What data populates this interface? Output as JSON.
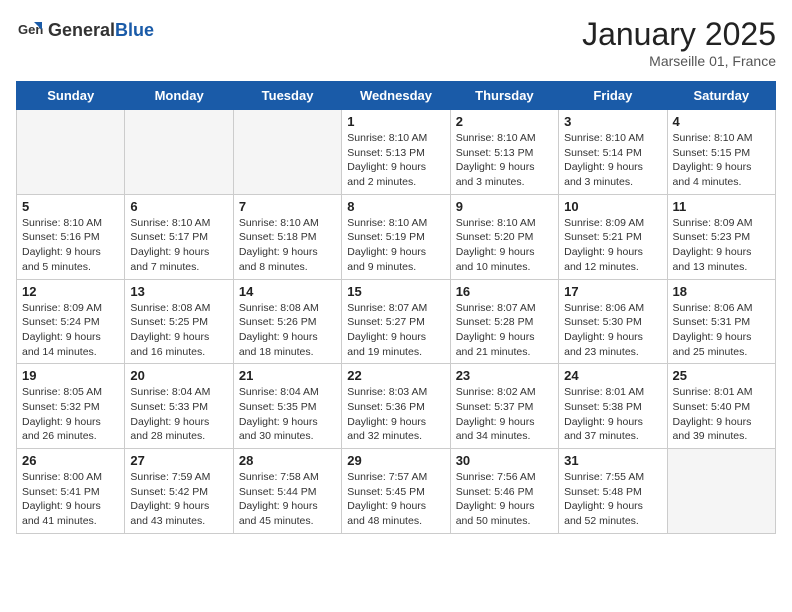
{
  "logo": {
    "general": "General",
    "blue": "Blue"
  },
  "title": "January 2025",
  "location": "Marseille 01, France",
  "weekdays": [
    "Sunday",
    "Monday",
    "Tuesday",
    "Wednesday",
    "Thursday",
    "Friday",
    "Saturday"
  ],
  "weeks": [
    [
      {
        "day": "",
        "info": ""
      },
      {
        "day": "",
        "info": ""
      },
      {
        "day": "",
        "info": ""
      },
      {
        "day": "1",
        "info": "Sunrise: 8:10 AM\nSunset: 5:13 PM\nDaylight: 9 hours\nand 2 minutes."
      },
      {
        "day": "2",
        "info": "Sunrise: 8:10 AM\nSunset: 5:13 PM\nDaylight: 9 hours\nand 3 minutes."
      },
      {
        "day": "3",
        "info": "Sunrise: 8:10 AM\nSunset: 5:14 PM\nDaylight: 9 hours\nand 3 minutes."
      },
      {
        "day": "4",
        "info": "Sunrise: 8:10 AM\nSunset: 5:15 PM\nDaylight: 9 hours\nand 4 minutes."
      }
    ],
    [
      {
        "day": "5",
        "info": "Sunrise: 8:10 AM\nSunset: 5:16 PM\nDaylight: 9 hours\nand 5 minutes."
      },
      {
        "day": "6",
        "info": "Sunrise: 8:10 AM\nSunset: 5:17 PM\nDaylight: 9 hours\nand 7 minutes."
      },
      {
        "day": "7",
        "info": "Sunrise: 8:10 AM\nSunset: 5:18 PM\nDaylight: 9 hours\nand 8 minutes."
      },
      {
        "day": "8",
        "info": "Sunrise: 8:10 AM\nSunset: 5:19 PM\nDaylight: 9 hours\nand 9 minutes."
      },
      {
        "day": "9",
        "info": "Sunrise: 8:10 AM\nSunset: 5:20 PM\nDaylight: 9 hours\nand 10 minutes."
      },
      {
        "day": "10",
        "info": "Sunrise: 8:09 AM\nSunset: 5:21 PM\nDaylight: 9 hours\nand 12 minutes."
      },
      {
        "day": "11",
        "info": "Sunrise: 8:09 AM\nSunset: 5:23 PM\nDaylight: 9 hours\nand 13 minutes."
      }
    ],
    [
      {
        "day": "12",
        "info": "Sunrise: 8:09 AM\nSunset: 5:24 PM\nDaylight: 9 hours\nand 14 minutes."
      },
      {
        "day": "13",
        "info": "Sunrise: 8:08 AM\nSunset: 5:25 PM\nDaylight: 9 hours\nand 16 minutes."
      },
      {
        "day": "14",
        "info": "Sunrise: 8:08 AM\nSunset: 5:26 PM\nDaylight: 9 hours\nand 18 minutes."
      },
      {
        "day": "15",
        "info": "Sunrise: 8:07 AM\nSunset: 5:27 PM\nDaylight: 9 hours\nand 19 minutes."
      },
      {
        "day": "16",
        "info": "Sunrise: 8:07 AM\nSunset: 5:28 PM\nDaylight: 9 hours\nand 21 minutes."
      },
      {
        "day": "17",
        "info": "Sunrise: 8:06 AM\nSunset: 5:30 PM\nDaylight: 9 hours\nand 23 minutes."
      },
      {
        "day": "18",
        "info": "Sunrise: 8:06 AM\nSunset: 5:31 PM\nDaylight: 9 hours\nand 25 minutes."
      }
    ],
    [
      {
        "day": "19",
        "info": "Sunrise: 8:05 AM\nSunset: 5:32 PM\nDaylight: 9 hours\nand 26 minutes."
      },
      {
        "day": "20",
        "info": "Sunrise: 8:04 AM\nSunset: 5:33 PM\nDaylight: 9 hours\nand 28 minutes."
      },
      {
        "day": "21",
        "info": "Sunrise: 8:04 AM\nSunset: 5:35 PM\nDaylight: 9 hours\nand 30 minutes."
      },
      {
        "day": "22",
        "info": "Sunrise: 8:03 AM\nSunset: 5:36 PM\nDaylight: 9 hours\nand 32 minutes."
      },
      {
        "day": "23",
        "info": "Sunrise: 8:02 AM\nSunset: 5:37 PM\nDaylight: 9 hours\nand 34 minutes."
      },
      {
        "day": "24",
        "info": "Sunrise: 8:01 AM\nSunset: 5:38 PM\nDaylight: 9 hours\nand 37 minutes."
      },
      {
        "day": "25",
        "info": "Sunrise: 8:01 AM\nSunset: 5:40 PM\nDaylight: 9 hours\nand 39 minutes."
      }
    ],
    [
      {
        "day": "26",
        "info": "Sunrise: 8:00 AM\nSunset: 5:41 PM\nDaylight: 9 hours\nand 41 minutes."
      },
      {
        "day": "27",
        "info": "Sunrise: 7:59 AM\nSunset: 5:42 PM\nDaylight: 9 hours\nand 43 minutes."
      },
      {
        "day": "28",
        "info": "Sunrise: 7:58 AM\nSunset: 5:44 PM\nDaylight: 9 hours\nand 45 minutes."
      },
      {
        "day": "29",
        "info": "Sunrise: 7:57 AM\nSunset: 5:45 PM\nDaylight: 9 hours\nand 48 minutes."
      },
      {
        "day": "30",
        "info": "Sunrise: 7:56 AM\nSunset: 5:46 PM\nDaylight: 9 hours\nand 50 minutes."
      },
      {
        "day": "31",
        "info": "Sunrise: 7:55 AM\nSunset: 5:48 PM\nDaylight: 9 hours\nand 52 minutes."
      },
      {
        "day": "",
        "info": ""
      }
    ]
  ]
}
